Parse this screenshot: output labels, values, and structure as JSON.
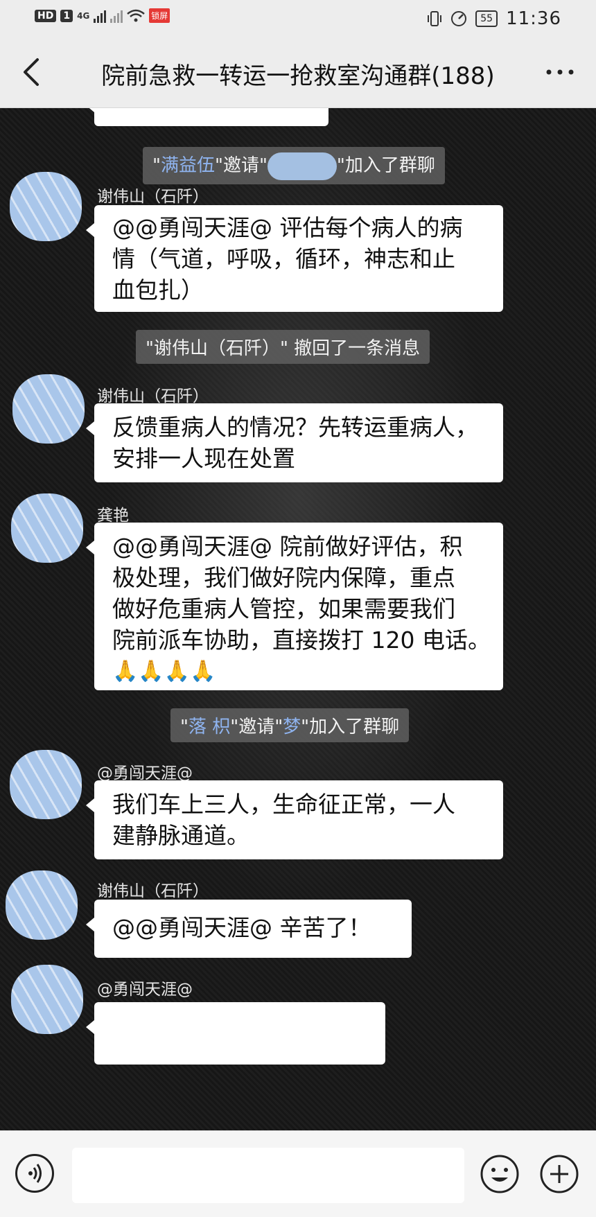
{
  "status_bar": {
    "left_badges": [
      "HD",
      "1",
      "4G"
    ],
    "red_badge": "锁屏",
    "battery": "55",
    "time": "11:36"
  },
  "header": {
    "title": "院前急救一转运一抢救室沟通群(188)"
  },
  "messages": {
    "sys1": {
      "q1": "\"",
      "name": "满益伍",
      "mid": "\"邀请\"",
      "end": "\"加入了群聊"
    },
    "m1": {
      "sender": "谢伟山（石阡）",
      "lines": [
        "@@勇闯天涯@ 评估每个病人的病",
        "情（气道，呼吸，循环，神志和止",
        "血包扎）"
      ]
    },
    "sys2": {
      "text": "\"谢伟山（石阡）\" 撤回了一条消息"
    },
    "m2": {
      "sender": "谢伟山（石阡）",
      "lines": [
        "反馈重病人的情况？先转运重病人，",
        "安排一人现在处置"
      ]
    },
    "m3": {
      "sender": "龚艳",
      "lines": [
        "@@勇闯天涯@ 院前做好评估，积",
        "极处理，我们做好院内保障，重点",
        "做好危重病人管控，如果需要我们",
        "院前派车协助，直接拨打 120 电话。"
      ],
      "emoji": "🙏🙏🙏🙏"
    },
    "sys3": {
      "q1": "\"",
      "name1": "落 枳",
      "mid": "\"邀请\"",
      "name2": "梦",
      "end": "\"加入了群聊"
    },
    "m4": {
      "sender": "@勇闯天涯@",
      "lines": [
        "我们车上三人，生命征正常，一人",
        "建静脉通道。"
      ]
    },
    "m5": {
      "sender": "谢伟山（石阡）",
      "lines": [
        "@@勇闯天涯@ 辛苦了！"
      ]
    },
    "m6": {
      "sender": "@勇闯天涯@"
    }
  },
  "icons": {
    "back": "chevron-left-icon",
    "more": "more-dots-icon",
    "voice": "voice-icon",
    "emoji": "smiley-icon",
    "plus": "plus-icon"
  }
}
